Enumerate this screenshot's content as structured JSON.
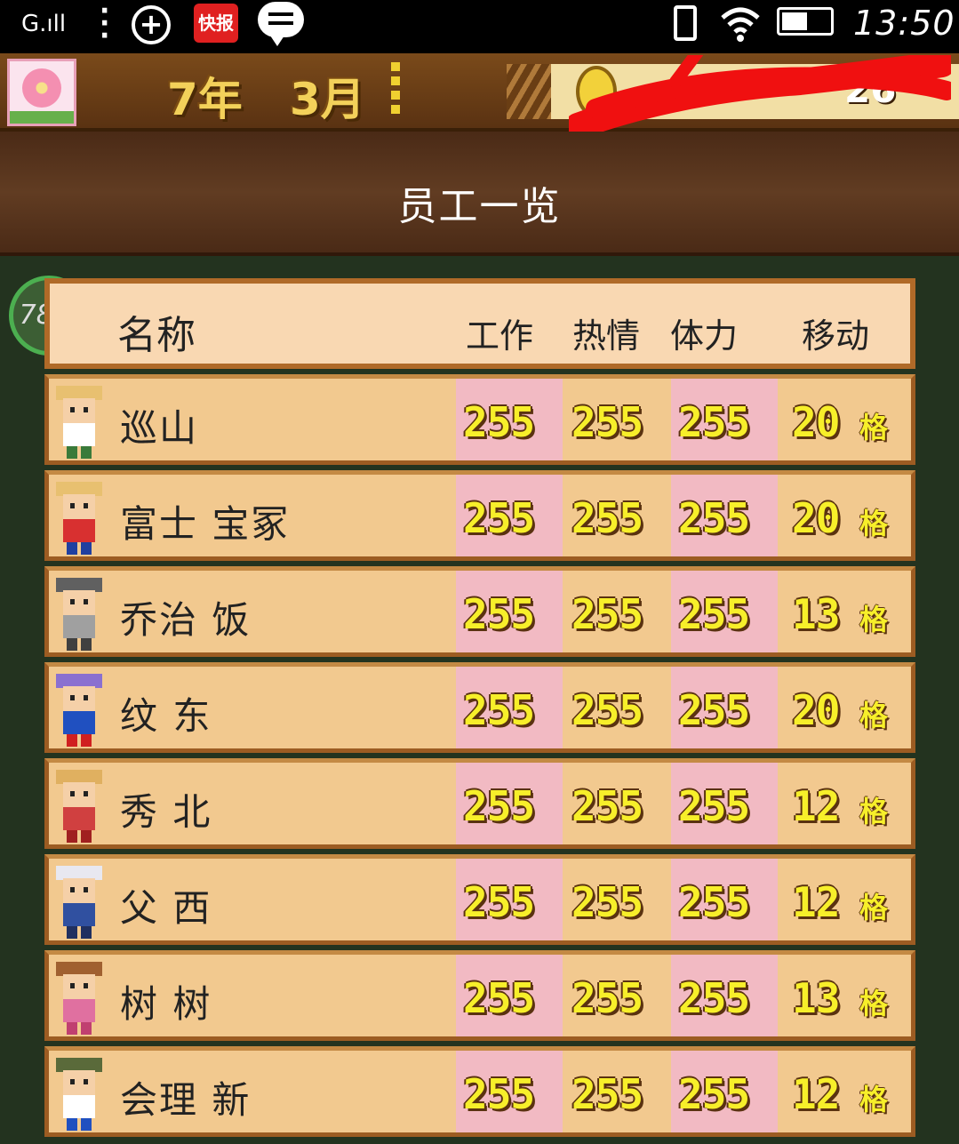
{
  "status_bar": {
    "signal": "G.ıll",
    "news_badge": "快报",
    "time": "13:50"
  },
  "game_header": {
    "year_label": "7年",
    "month_label": "3月",
    "money_visible": "26"
  },
  "screen_title": "员工一览",
  "progress_badge": "78%",
  "table": {
    "headers": {
      "name": "名称",
      "work": "工作",
      "passion": "热情",
      "stamina": "体力",
      "move": "移动"
    },
    "move_unit": "格",
    "rows": [
      {
        "name": "巡山",
        "work": "255",
        "passion": "255",
        "stamina": "255",
        "move": "20",
        "sprite": "straw-hat-worker"
      },
      {
        "name": "富士 宝冢",
        "work": "255",
        "passion": "255",
        "stamina": "255",
        "move": "20",
        "sprite": "straw-hat-red"
      },
      {
        "name": "乔治 饭",
        "work": "255",
        "passion": "255",
        "stamina": "255",
        "move": "13",
        "sprite": "glasses-old-man"
      },
      {
        "name": "纹 东",
        "work": "255",
        "passion": "255",
        "stamina": "255",
        "move": "20",
        "sprite": "party-hat"
      },
      {
        "name": "秀 北",
        "work": "255",
        "passion": "255",
        "stamina": "255",
        "move": "12",
        "sprite": "pink-girl"
      },
      {
        "name": "父 西",
        "work": "255",
        "passion": "255",
        "stamina": "255",
        "move": "12",
        "sprite": "white-hair-man"
      },
      {
        "name": "树 树",
        "work": "255",
        "passion": "255",
        "stamina": "255",
        "move": "13",
        "sprite": "goggles-girl"
      },
      {
        "name": "会理 新",
        "work": "255",
        "passion": "255",
        "stamina": "255",
        "move": "12",
        "sprite": "green-cap-boy"
      }
    ]
  },
  "colors": {
    "header_brown": "#5a3212",
    "row_bg": "#f2c98f",
    "pink_col": "#f2bac3",
    "value_yellow": "#f7ef2a"
  }
}
